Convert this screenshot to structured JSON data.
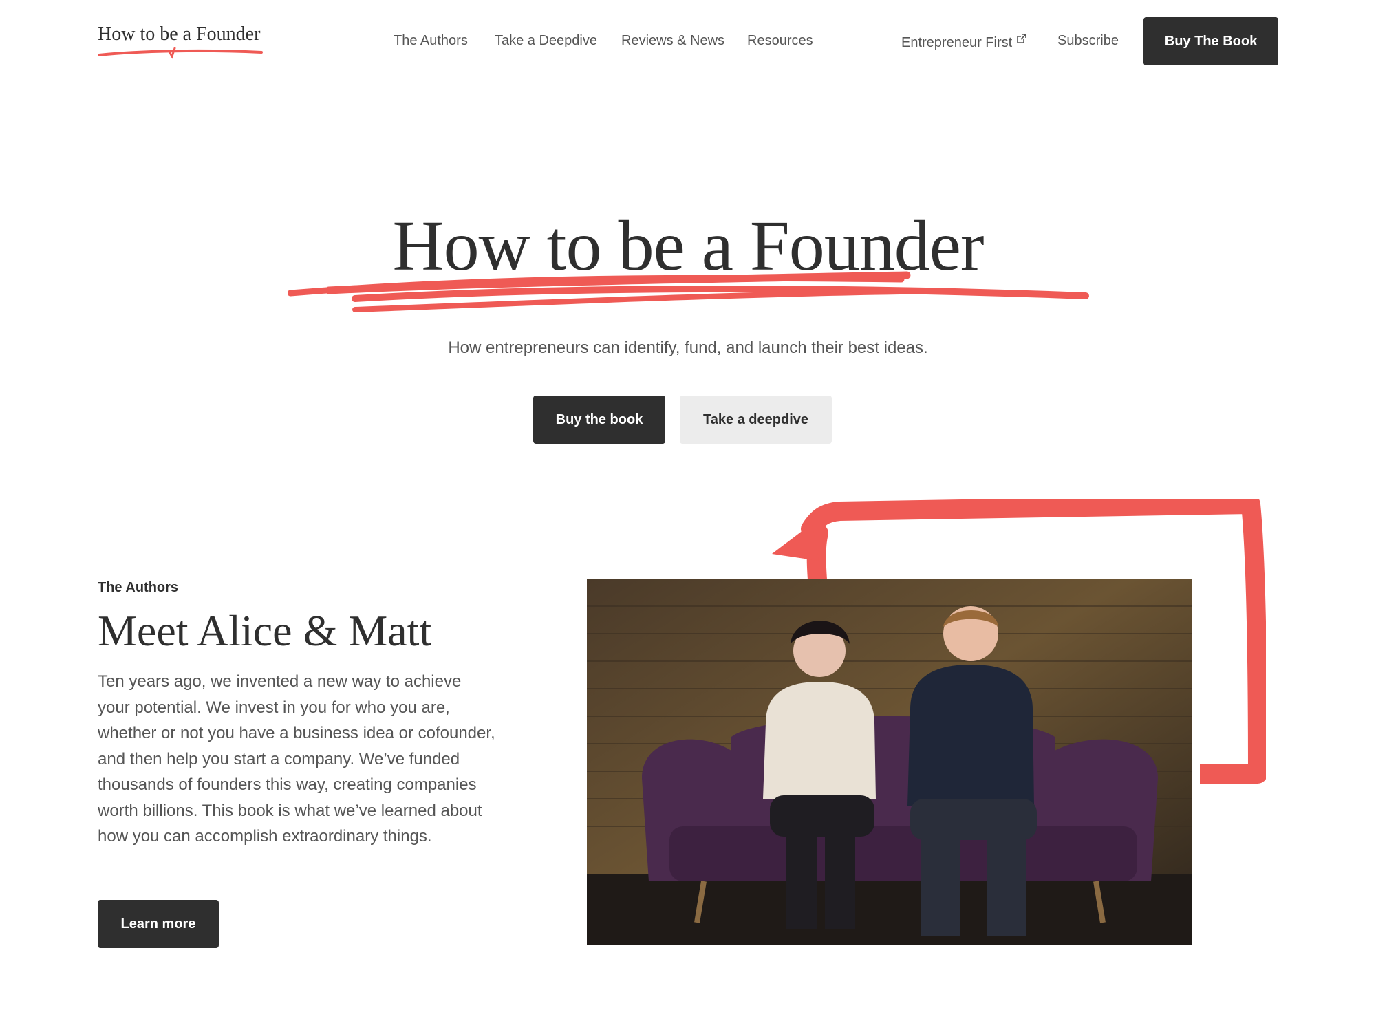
{
  "header": {
    "logo_text": "How to be a Founder",
    "nav": {
      "authors": "The Authors",
      "deepdive": "Take a Deepdive",
      "reviews": "Reviews & News",
      "resources": "Resources",
      "entrepreneur_first": "Entrepreneur First",
      "subscribe": "Subscribe"
    },
    "cta": "Buy The Book"
  },
  "hero": {
    "title": "How to be a Founder",
    "subtitle": "How entrepreneurs can identify, fund, and launch their best ideas.",
    "buy_button": "Buy the book",
    "deepdive_button": "Take a deepdive"
  },
  "authors": {
    "eyebrow": "The Authors",
    "title": "Meet Alice & Matt",
    "body": "Ten years ago, we invented a new way to achieve your potential. We invest in you for who you are, whether or not you have a business idea or cofounder, and then help you start a company. We’ve funded thousands of founders this way, creating companies worth billions. This book is what we’ve learned about how you can accomplish extraordinary things.",
    "learn_more": "Learn more"
  },
  "colors": {
    "accent": "#ef5a55",
    "dark": "#2f2f2f",
    "light_button": "#ececec"
  },
  "icons": {
    "external_link": "external-link-icon"
  }
}
